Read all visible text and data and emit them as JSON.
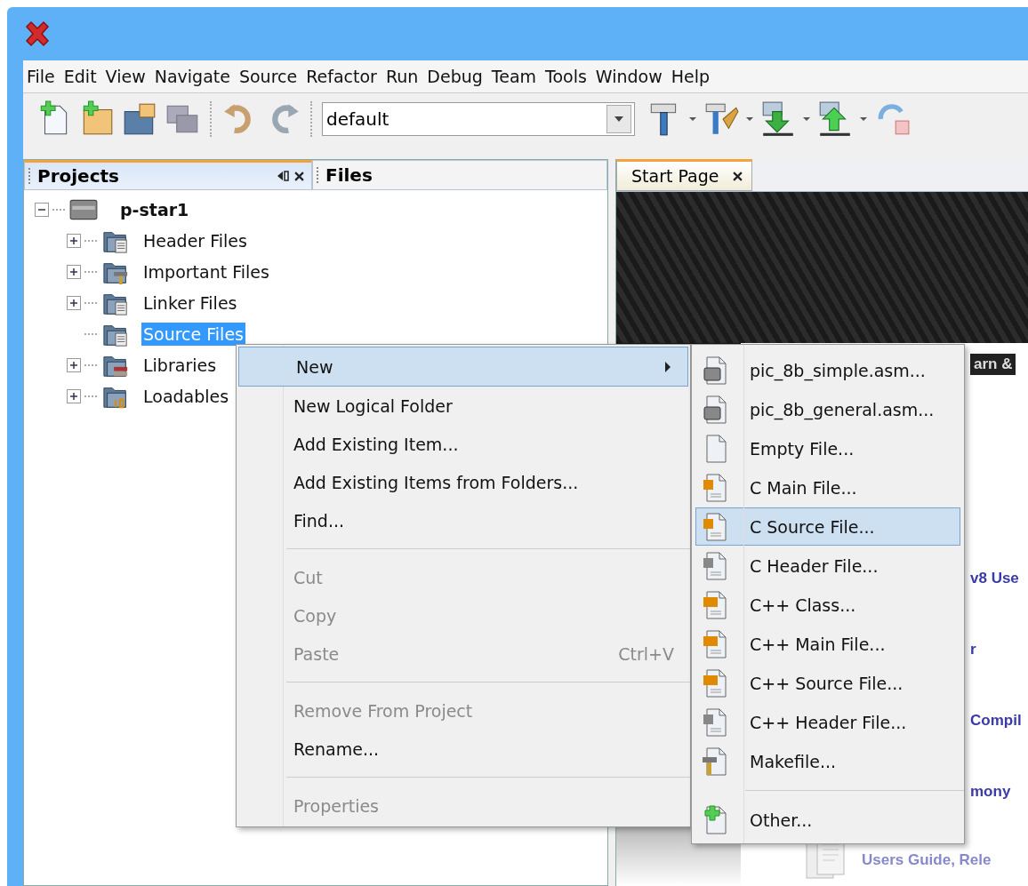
{
  "menu_bar": [
    "File",
    "Edit",
    "View",
    "Navigate",
    "Source",
    "Refactor",
    "Run",
    "Debug",
    "Team",
    "Tools",
    "Window",
    "Help"
  ],
  "toolbar": {
    "configuration": "default"
  },
  "left_tabs": [
    {
      "label": "Projects",
      "selected": true
    },
    {
      "label": "Files",
      "selected": false
    }
  ],
  "project_tree": {
    "label": "p-star1",
    "expanded": true,
    "children": [
      {
        "label": "Header Files",
        "kind": "list",
        "expandable": true,
        "selected": false
      },
      {
        "label": "Important Files",
        "kind": "hammer",
        "expandable": true,
        "selected": false
      },
      {
        "label": "Linker Files",
        "kind": "list",
        "expandable": true,
        "selected": false
      },
      {
        "label": "Source Files",
        "kind": "list",
        "expandable": false,
        "selected": true
      },
      {
        "label": "Libraries",
        "kind": "books",
        "expandable": true,
        "selected": false
      },
      {
        "label": "Loadables",
        "kind": "binary",
        "expandable": true,
        "selected": false
      }
    ]
  },
  "editor_tabs": [
    {
      "label": "Start Page",
      "selected": true
    }
  ],
  "start_page_fragments": [
    {
      "text": "arn &",
      "kind": "banner"
    },
    {
      "text": "v8 Use",
      "kind": "link"
    },
    {
      "text": "r",
      "kind": "link"
    },
    {
      "text": "Compil",
      "kind": "link"
    },
    {
      "text": "mony",
      "kind": "link"
    },
    {
      "text": "Users Guide, Rele",
      "kind": "doc"
    }
  ],
  "context_menu": [
    {
      "kind": "item",
      "label": "New",
      "disabled": false,
      "highlighted": true,
      "submenu": true
    },
    {
      "kind": "item",
      "label": "New Logical Folder",
      "disabled": false,
      "highlighted": false,
      "submenu": false
    },
    {
      "kind": "item",
      "label": "Add Existing Item...",
      "disabled": false,
      "highlighted": false,
      "submenu": false
    },
    {
      "kind": "item",
      "label": "Add Existing Items from Folders...",
      "disabled": false,
      "highlighted": false,
      "submenu": false
    },
    {
      "kind": "item",
      "label": "Find...",
      "disabled": false,
      "highlighted": false,
      "submenu": false
    },
    {
      "kind": "separator"
    },
    {
      "kind": "item",
      "label": "Cut",
      "disabled": true,
      "highlighted": false,
      "submenu": false
    },
    {
      "kind": "item",
      "label": "Copy",
      "disabled": true,
      "highlighted": false,
      "submenu": false
    },
    {
      "kind": "item",
      "label": "Paste",
      "disabled": true,
      "highlighted": false,
      "submenu": false,
      "shortcut": "Ctrl+V"
    },
    {
      "kind": "separator"
    },
    {
      "kind": "item",
      "label": "Remove From Project",
      "disabled": true,
      "highlighted": false,
      "submenu": false
    },
    {
      "kind": "item",
      "label": "Rename...",
      "disabled": false,
      "highlighted": false,
      "submenu": false
    },
    {
      "kind": "separator"
    },
    {
      "kind": "item",
      "label": "Properties",
      "disabled": true,
      "highlighted": false,
      "submenu": false
    }
  ],
  "submenu": [
    {
      "kind": "chip",
      "label": "pic_8b_simple.asm...",
      "selected": false
    },
    {
      "kind": "chip",
      "label": "pic_8b_general.asm...",
      "selected": false
    },
    {
      "kind": "blank",
      "label": "Empty File...",
      "selected": false
    },
    {
      "kind": "c",
      "label": "C Main File...",
      "selected": false
    },
    {
      "kind": "c",
      "label": "C Source File...",
      "selected": true
    },
    {
      "kind": "h",
      "label": "C Header File...",
      "selected": false
    },
    {
      "kind": "cc",
      "label": "C++ Class...",
      "selected": false
    },
    {
      "kind": "cc",
      "label": "C++ Main File...",
      "selected": false
    },
    {
      "kind": "cc",
      "label": "C++ Source File...",
      "selected": false
    },
    {
      "kind": "h",
      "label": "C++ Header File...",
      "selected": false
    },
    {
      "kind": "hammer",
      "label": "Makefile...",
      "selected": false
    },
    {
      "kind": "separator"
    },
    {
      "kind": "plus",
      "label": "Other...",
      "selected": false
    }
  ]
}
